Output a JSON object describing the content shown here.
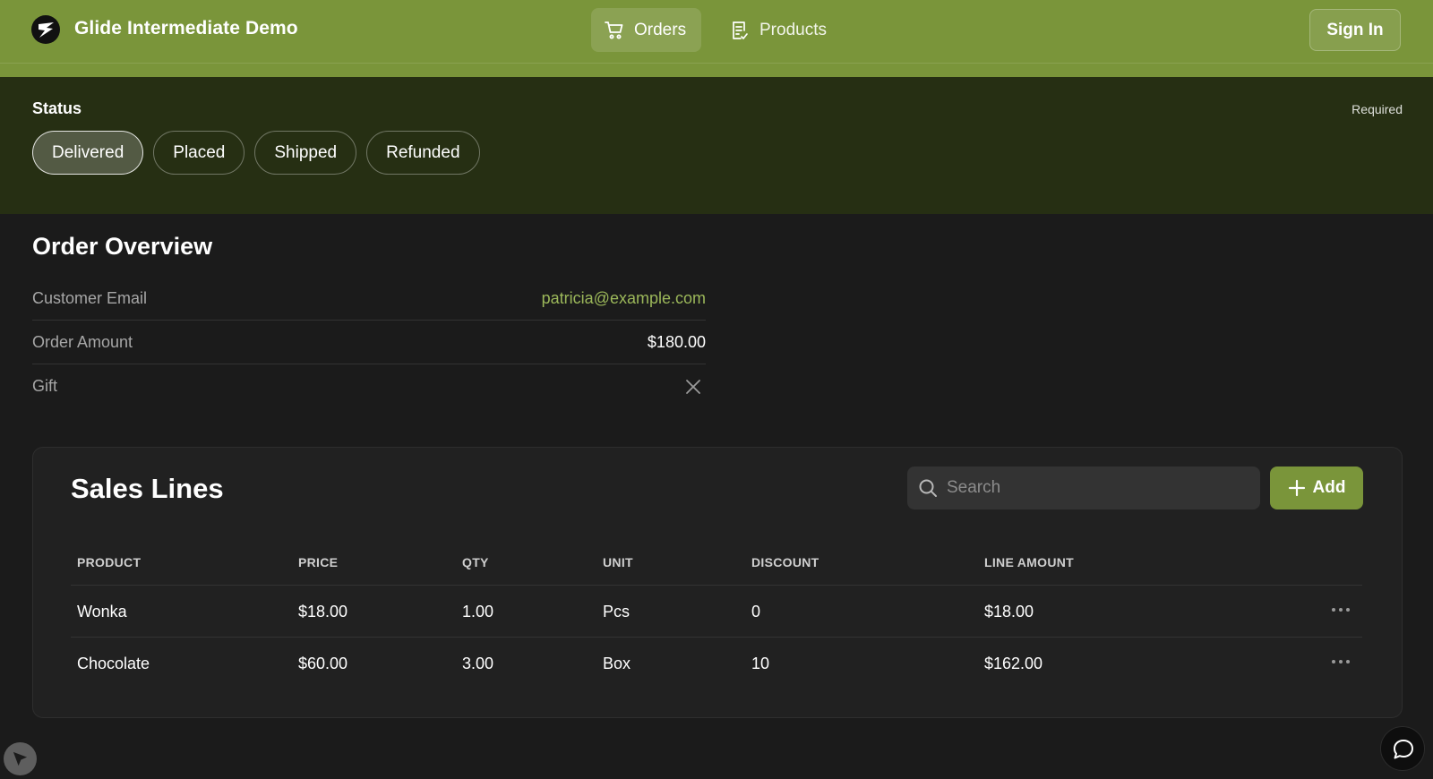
{
  "app": {
    "title": "Glide Intermediate Demo",
    "accent_color": "#7a953a",
    "logo_icon": "glide-logo-icon"
  },
  "nav": {
    "tabs": [
      {
        "label": "Orders",
        "icon": "cart-icon",
        "active": true
      },
      {
        "label": "Products",
        "icon": "document-list-icon",
        "active": false
      }
    ],
    "sign_in_label": "Sign In"
  },
  "status": {
    "label": "Status",
    "required_label": "Required",
    "options": [
      "Delivered",
      "Placed",
      "Shipped",
      "Refunded"
    ],
    "selected": "Delivered"
  },
  "overview": {
    "title": "Order Overview",
    "rows": [
      {
        "label": "Customer Email",
        "value": "patricia@example.com"
      },
      {
        "label": "Order Amount",
        "value": "$180.00"
      },
      {
        "label": "Gift",
        "value": "",
        "icon": "close-icon"
      }
    ]
  },
  "sales_lines": {
    "title": "Sales Lines",
    "search_placeholder": "Search",
    "add_label": "Add",
    "columns": [
      "PRODUCT",
      "PRICE",
      "QTY",
      "UNIT",
      "DISCOUNT",
      "LINE AMOUNT"
    ],
    "rows": [
      {
        "product": "Wonka",
        "price": "$18.00",
        "qty": "1.00",
        "unit": "Pcs",
        "discount": "0",
        "line_amount": "$18.00"
      },
      {
        "product": "Chocolate",
        "price": "$60.00",
        "qty": "3.00",
        "unit": "Box",
        "discount": "10",
        "line_amount": "$162.00"
      }
    ]
  },
  "floating": {
    "left_icon": "cursor-arrow-icon",
    "right_icon": "chat-bubble-icon"
  }
}
